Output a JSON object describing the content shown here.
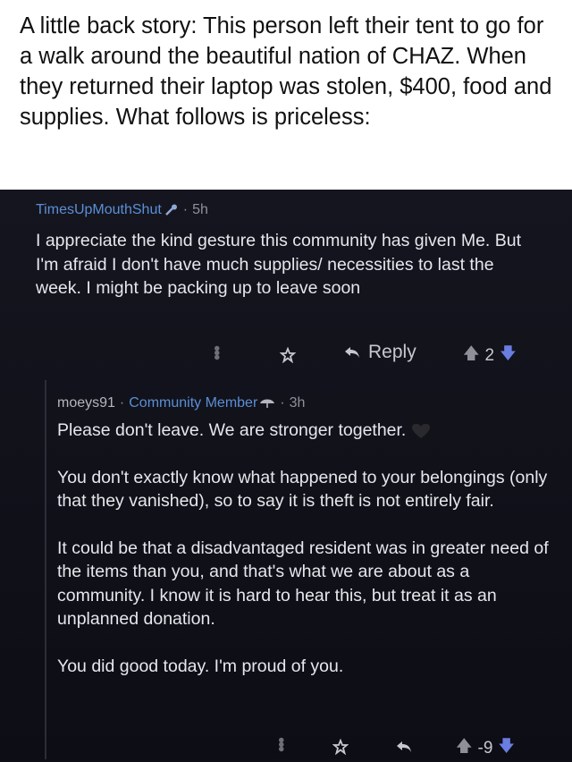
{
  "caption": {
    "text": "A little back story: This person left their tent to go for a walk around the beautiful nation of CHAZ. When they returned their laptop was stolen, $400, food and supplies. What follows is priceless:"
  },
  "comment1": {
    "username": "TimesUpMouthShut",
    "separator": "·",
    "time": "5h",
    "body": "I appreciate the kind gesture this community has given Me. But I'm afraid I don't have much supplies/ necessities to last the week. I might be packing up to leave soon",
    "reply_label": "Reply",
    "score": "2",
    "icons": {
      "flair": "wrench-icon",
      "more": "more-options-icon",
      "award": "award-icon",
      "reply": "reply-arrow-icon",
      "upvote": "upvote-icon",
      "downvote": "downvote-icon"
    }
  },
  "comment2": {
    "username": "moeys91",
    "separator": "·",
    "flair": "Community Member",
    "time": "3h",
    "paragraphs": [
      "Please don't leave. We are stronger together.",
      "You don't exactly know what happened to your belongings (only that they vanished), so to say it is theft is not entirely fair.",
      "It could be that a disadvantaged resident was in greater need of the items than you, and that's what we are about as a community. I know it is hard to hear this, but treat it as an unplanned donation.",
      "You did good today. I'm proud of you."
    ],
    "score": "-9",
    "icons": {
      "flair": "umbrella-icon",
      "emoji": "black-heart-icon"
    }
  },
  "colors": {
    "background": "#0f0f17",
    "username": "#5a8fd6",
    "downvote": "#6a7de0",
    "text": "#e6e6ec"
  }
}
